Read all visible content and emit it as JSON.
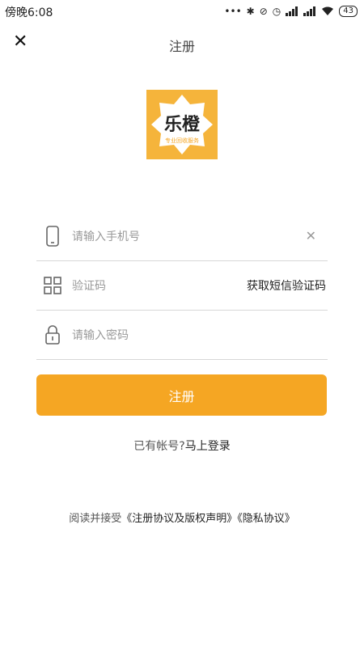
{
  "status_bar": {
    "time": "傍晚6:08",
    "icons": [
      "dots-icon",
      "bluetooth-icon",
      "mute-icon",
      "alarm-icon",
      "signal-icon",
      "signal-icon",
      "wifi-icon"
    ],
    "battery": "43"
  },
  "header": {
    "title": "注册",
    "close_icon": "close-icon"
  },
  "logo": {
    "main_text": "乐橙",
    "sub_text": "专业回收服务",
    "color": "#F5B43B"
  },
  "form": {
    "phone": {
      "placeholder": "请输入手机号",
      "value": "",
      "icon": "phone-icon",
      "clear_icon": "clear-icon"
    },
    "code": {
      "placeholder": "验证码",
      "value": "",
      "icon": "grid-icon",
      "action_label": "获取短信验证码"
    },
    "password": {
      "placeholder": "请输入密码",
      "value": "",
      "icon": "lock-icon"
    }
  },
  "register_button": {
    "label": "注册",
    "color": "#F5A623"
  },
  "login_prompt": {
    "text": "已有帐号?",
    "link": "马上登录"
  },
  "agreement": {
    "text": "阅读并接受",
    "terms_link": "《注册协议及版权声明》",
    "privacy_link": "《隐私协议》"
  }
}
